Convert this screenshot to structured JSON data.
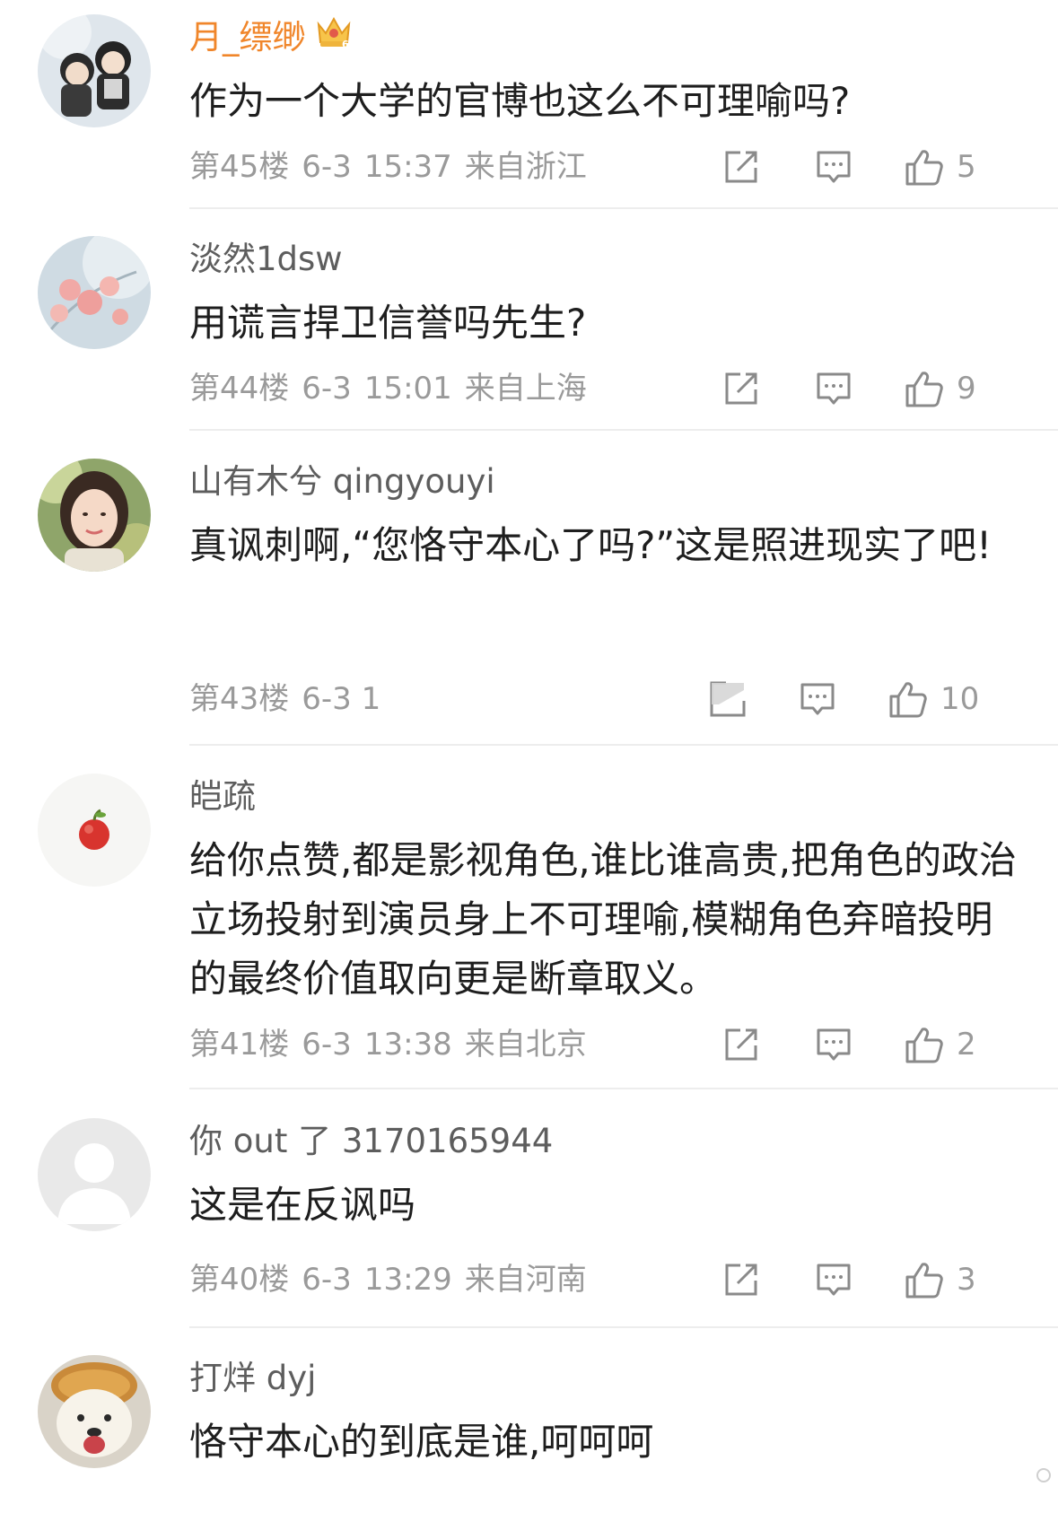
{
  "comments": [
    {
      "username": "月_缥缈",
      "vip": true,
      "text": "作为一个大学的官博也这么不可理喻吗?",
      "floor": "第45楼",
      "date": "6-3",
      "time": "15:37",
      "location": "来自浙江",
      "likes": "5",
      "avatar_icon": "two-dolls-avatar"
    },
    {
      "username": "淡然1dsw",
      "vip": false,
      "text": "用谎言捍卫信誉吗先生?",
      "floor": "第44楼",
      "date": "6-3",
      "time": "15:01",
      "location": "来自上海",
      "likes": "9",
      "avatar_icon": "pink-blossom-avatar"
    },
    {
      "username": "山有木兮 qingyouyi",
      "vip": false,
      "text": "真讽刺啊,“您恪守本心了吗?”这是照进现实了吧!",
      "floor": "第43楼",
      "date": "6-3 1",
      "time": "",
      "location": "",
      "likes": "10",
      "avatar_icon": "girl-portrait-avatar"
    },
    {
      "username": "皑疏",
      "vip": false,
      "text": "给你点赞,都是影视角色,谁比谁高贵,把角色的政治立场投射到演员身上不可理喻,模糊角色弃暗投明的最终价值取向更是断章取义。",
      "floor": "第41楼",
      "date": "6-3",
      "time": "13:38",
      "location": "来自北京",
      "likes": "2",
      "avatar_icon": "apple-avatar"
    },
    {
      "username": "你 out 了 3170165944",
      "vip": false,
      "text": "这是在反讽吗",
      "floor": "第40楼",
      "date": "6-3",
      "time": "13:29",
      "location": "来自河南",
      "likes": "3",
      "avatar_icon": "default-user-avatar"
    },
    {
      "username": "打烊 dyj",
      "vip": false,
      "text": "恪守本心的到底是谁,呵呵呵",
      "floor": "",
      "date": "",
      "time": "",
      "location": "",
      "likes": "",
      "avatar_icon": "puppy-avatar"
    }
  ],
  "icons": {
    "vip": "crown-badge-icon",
    "share": "share-icon",
    "reply": "reply-icon",
    "like": "like-thumb-icon"
  },
  "colors": {
    "vip_name": "#f0862b",
    "name": "#5d5d5d",
    "meta": "#9a9a9a",
    "text": "#1e1e1e"
  }
}
